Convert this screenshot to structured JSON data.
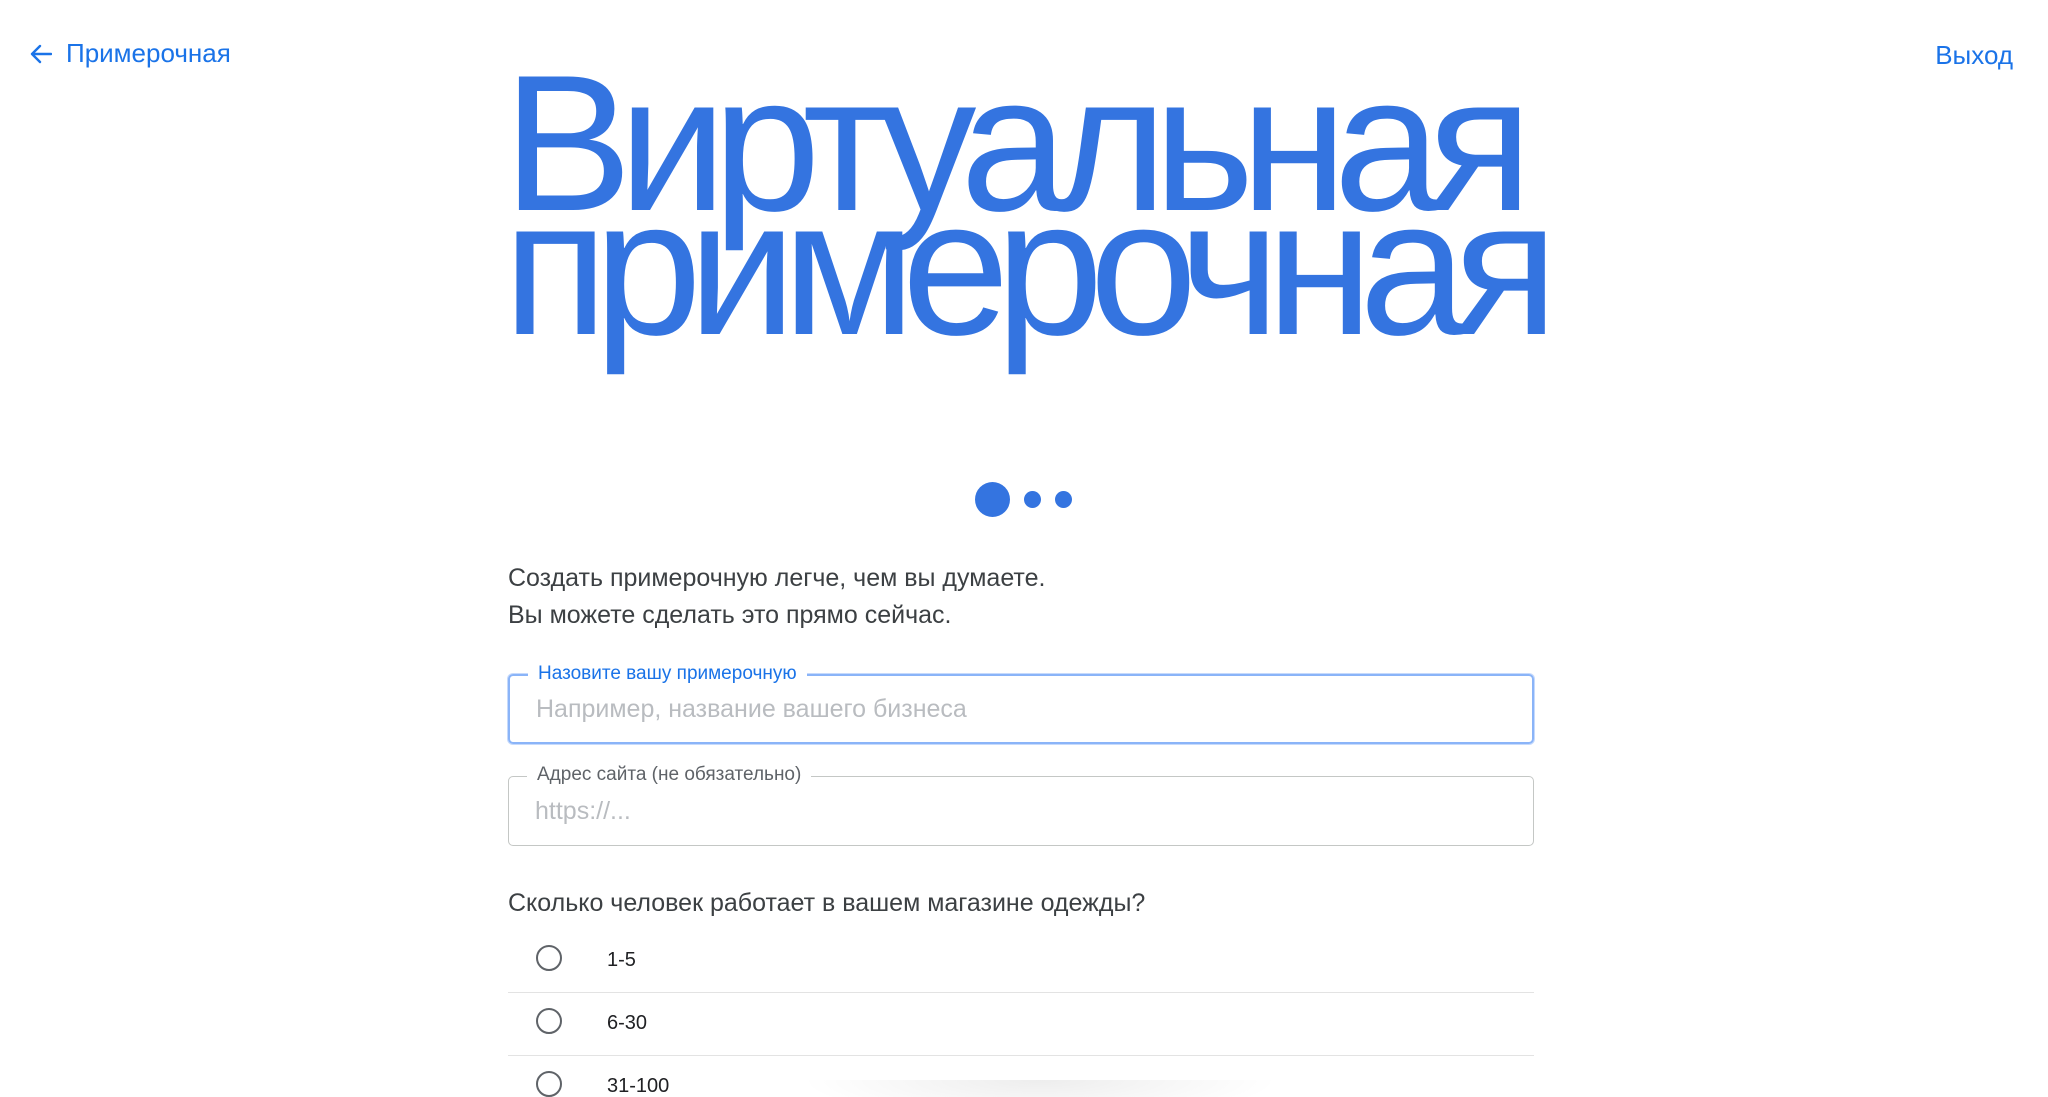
{
  "nav": {
    "back_label": "Примерочная",
    "exit_label": "Выход"
  },
  "hero": {
    "line1": "Виртуальная",
    "line2": "примерочная"
  },
  "steps": {
    "total": 3,
    "current": 1
  },
  "intro": {
    "line1": "Создать примерочную легче, чем вы думаете.",
    "line2": "Вы можете сделать это прямо сейчас."
  },
  "form": {
    "name_field": {
      "label": "Назовите вашу примерочную",
      "placeholder": "Например, название вашего бизнеса",
      "value": ""
    },
    "site_field": {
      "label": "Адрес сайта (не обязательно)",
      "placeholder": "https://...",
      "value": ""
    },
    "staff_question": "Сколько человек работает в вашем магазине одежды?",
    "staff_options": [
      "1-5",
      "6-30",
      "31-100"
    ]
  },
  "colors": {
    "accent": "#1a73e8",
    "hero": "#3474e0",
    "focus_border": "#8ab4f8"
  }
}
